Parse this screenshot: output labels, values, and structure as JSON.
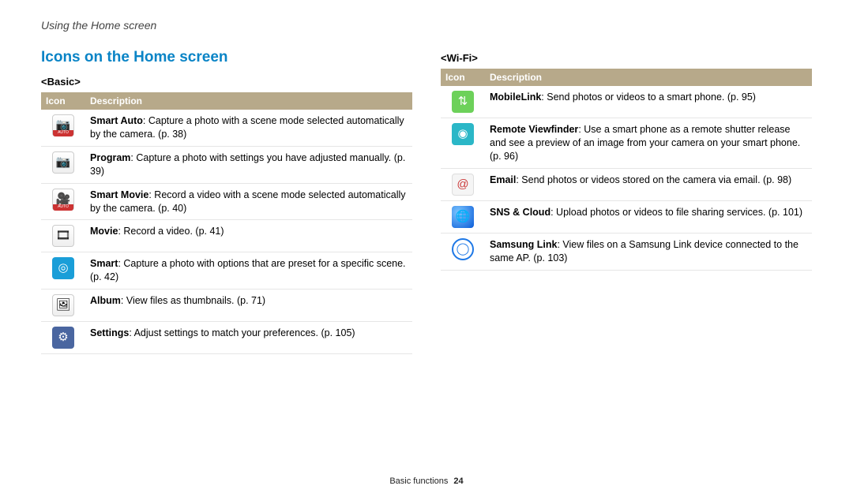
{
  "breadcrumb": "Using the Home screen",
  "section_title": "Icons on the Home screen",
  "table_headers": {
    "icon": "Icon",
    "description": "Description"
  },
  "basic": {
    "heading": "<Basic>",
    "rows": [
      {
        "icon_name": "smart-auto-icon",
        "glyph": "📷",
        "css": "ico-camera-auto",
        "bold": "Smart Auto",
        "rest": ": Capture a photo with a scene mode selected automatically by the camera. (p. 38)"
      },
      {
        "icon_name": "program-icon",
        "glyph": "📷",
        "css": "ico-camera",
        "bold": "Program",
        "rest": ": Capture a photo with settings you have adjusted manually. (p. 39)"
      },
      {
        "icon_name": "smart-movie-icon",
        "glyph": "🎥",
        "css": "ico-film-auto",
        "bold": "Smart Movie",
        "rest": ": Record a video with a scene mode selected automatically by the camera. (p. 40)"
      },
      {
        "icon_name": "movie-icon",
        "glyph": "🎞",
        "css": "ico-movie",
        "bold": "Movie",
        "rest": ": Record a video. (p. 41)"
      },
      {
        "icon_name": "smart-icon",
        "glyph": "◎",
        "css": "ico-smart",
        "bold": "Smart",
        "rest": ": Capture a photo with options that are preset for a specific scene. (p. 42)"
      },
      {
        "icon_name": "album-icon",
        "glyph": "🖼",
        "css": "ico-album",
        "bold": "Album",
        "rest": ": View files as thumbnails. (p. 71)"
      },
      {
        "icon_name": "settings-icon",
        "glyph": "⚙",
        "css": "ico-settings",
        "bold": "Settings",
        "rest": ": Adjust settings to match your preferences. (p. 105)"
      }
    ]
  },
  "wifi": {
    "heading": "<Wi-Fi>",
    "rows": [
      {
        "icon_name": "mobilelink-icon",
        "glyph": "⇅",
        "css": "ico-mobilelink",
        "bold": "MobileLink",
        "rest": ": Send photos or videos to a smart phone. (p. 95)"
      },
      {
        "icon_name": "remote-viewfinder-icon",
        "glyph": "◉",
        "css": "ico-remote",
        "bold": "Remote Viewfinder",
        "rest": ": Use a smart phone as a remote shutter release and see a preview of an image from your camera on your smart phone. (p. 96)"
      },
      {
        "icon_name": "email-icon",
        "glyph": "@",
        "css": "ico-email",
        "bold": "Email",
        "rest": ": Send photos or videos stored on the camera via email. (p. 98)"
      },
      {
        "icon_name": "sns-cloud-icon",
        "glyph": "🌐",
        "css": "ico-sns",
        "bold": "SNS & Cloud",
        "rest": ": Upload photos or videos to file sharing services. (p. 101)"
      },
      {
        "icon_name": "samsung-link-icon",
        "glyph": "◯",
        "css": "ico-samsunglink",
        "bold": "Samsung Link",
        "rest": ": View files on a Samsung Link device connected to the same AP. (p. 103)"
      }
    ]
  },
  "footer": {
    "section": "Basic functions",
    "page": "24"
  }
}
